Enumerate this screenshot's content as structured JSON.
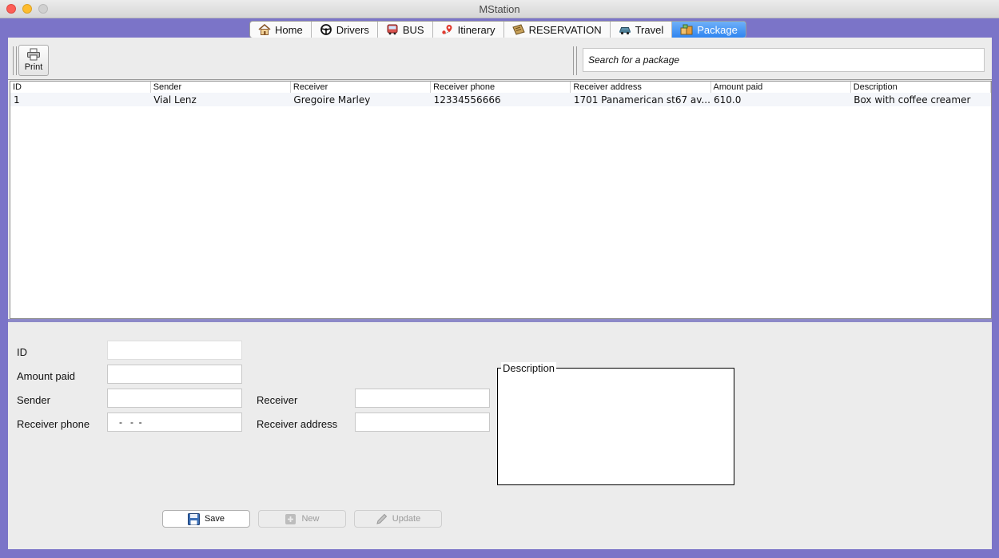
{
  "window": {
    "title": "MStation"
  },
  "tabs": [
    {
      "label": "Home",
      "icon": "home-icon"
    },
    {
      "label": "Drivers",
      "icon": "steering-wheel-icon"
    },
    {
      "label": "BUS",
      "icon": "bus-icon"
    },
    {
      "label": "Itinerary",
      "icon": "map-pin-icon"
    },
    {
      "label": "RESERVATION",
      "icon": "ticket-icon"
    },
    {
      "label": "Travel",
      "icon": "car-icon"
    },
    {
      "label": "Package",
      "icon": "package-icon",
      "active": true
    }
  ],
  "toolbar": {
    "print_label": "Print",
    "search_placeholder": "Search for a package"
  },
  "table": {
    "columns": [
      "ID",
      "Sender",
      "Receiver",
      "Receiver phone",
      "Receiver address",
      "Amount paid",
      "Description"
    ],
    "rows": [
      [
        "1",
        "Vial Lenz",
        "Gregoire Marley",
        "12334556666",
        "1701 Panamerican st67 av...",
        "610.0",
        "Box with coffee creamer"
      ]
    ]
  },
  "form": {
    "id_label": "ID",
    "amount_label": "Amount paid",
    "sender_label": "Sender",
    "receiver_label": "Receiver",
    "phone_label": "Receiver phone",
    "phone_value": "-   -  -",
    "address_label": "Receiver address",
    "description_label": "Description"
  },
  "buttons": {
    "save": "Save",
    "new": "New",
    "update": "Update"
  },
  "colors": {
    "window_bg": "#7b74c8",
    "active_tab": "#2f85f0"
  }
}
